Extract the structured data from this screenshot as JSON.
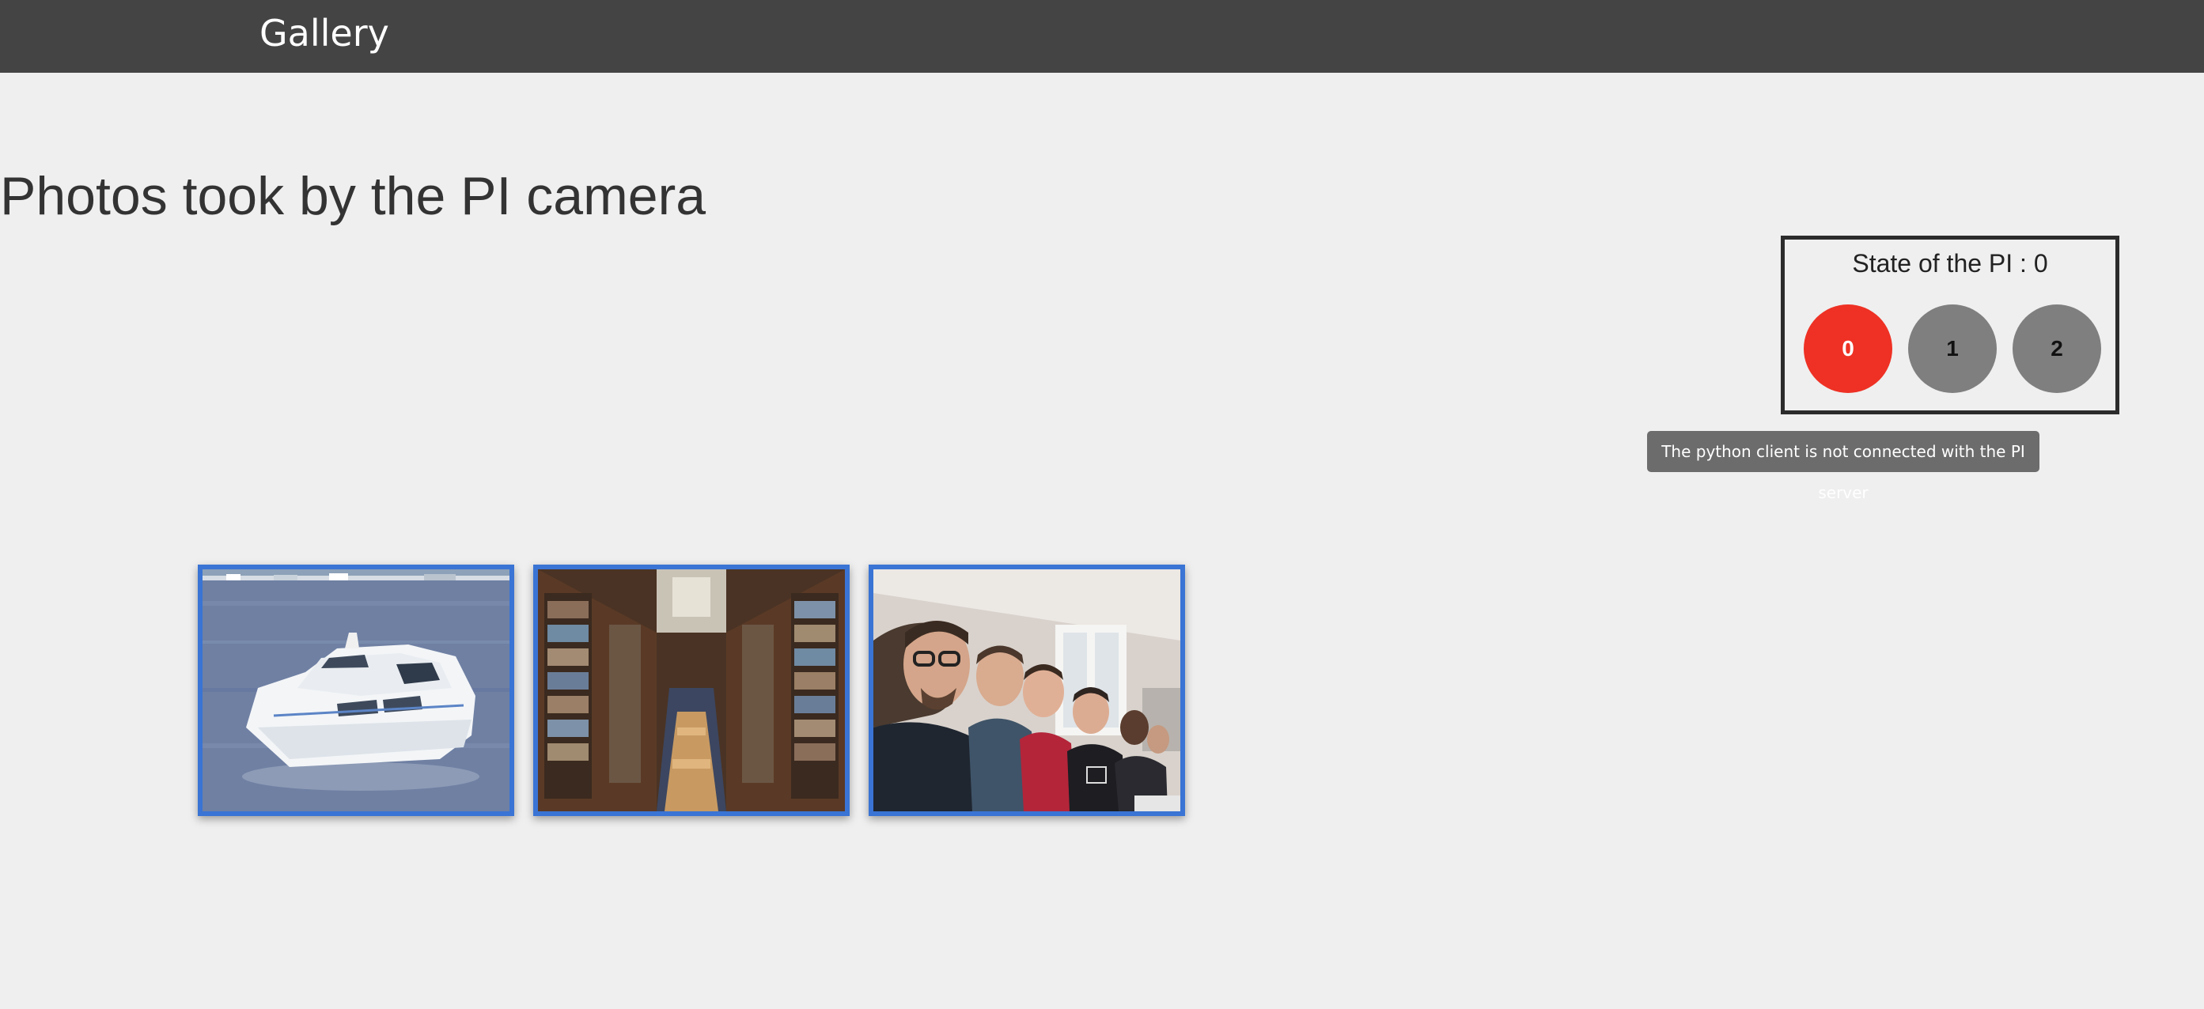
{
  "navbar": {
    "brand": "Gallery"
  },
  "page": {
    "title": "Photos took by the PI camera"
  },
  "state_panel": {
    "title": "State of the PI : 0",
    "current_state": 0,
    "buttons": [
      {
        "label": "0",
        "color": "#ee3124",
        "text_color": "#ffffff",
        "active": true
      },
      {
        "label": "1",
        "color": "#7f7f7f",
        "text_color": "#111111",
        "active": false
      },
      {
        "label": "2",
        "color": "#7f7f7f",
        "text_color": "#111111",
        "active": false
      }
    ]
  },
  "tooltip": {
    "text": "The python client is not connected with the PI server"
  },
  "gallery": {
    "border_color": "#3a74d4",
    "photos": [
      {
        "subject": "white motor boat on water"
      },
      {
        "subject": "library aisle with bookshelves"
      },
      {
        "subject": "group selfie of young men in a classroom"
      }
    ]
  }
}
